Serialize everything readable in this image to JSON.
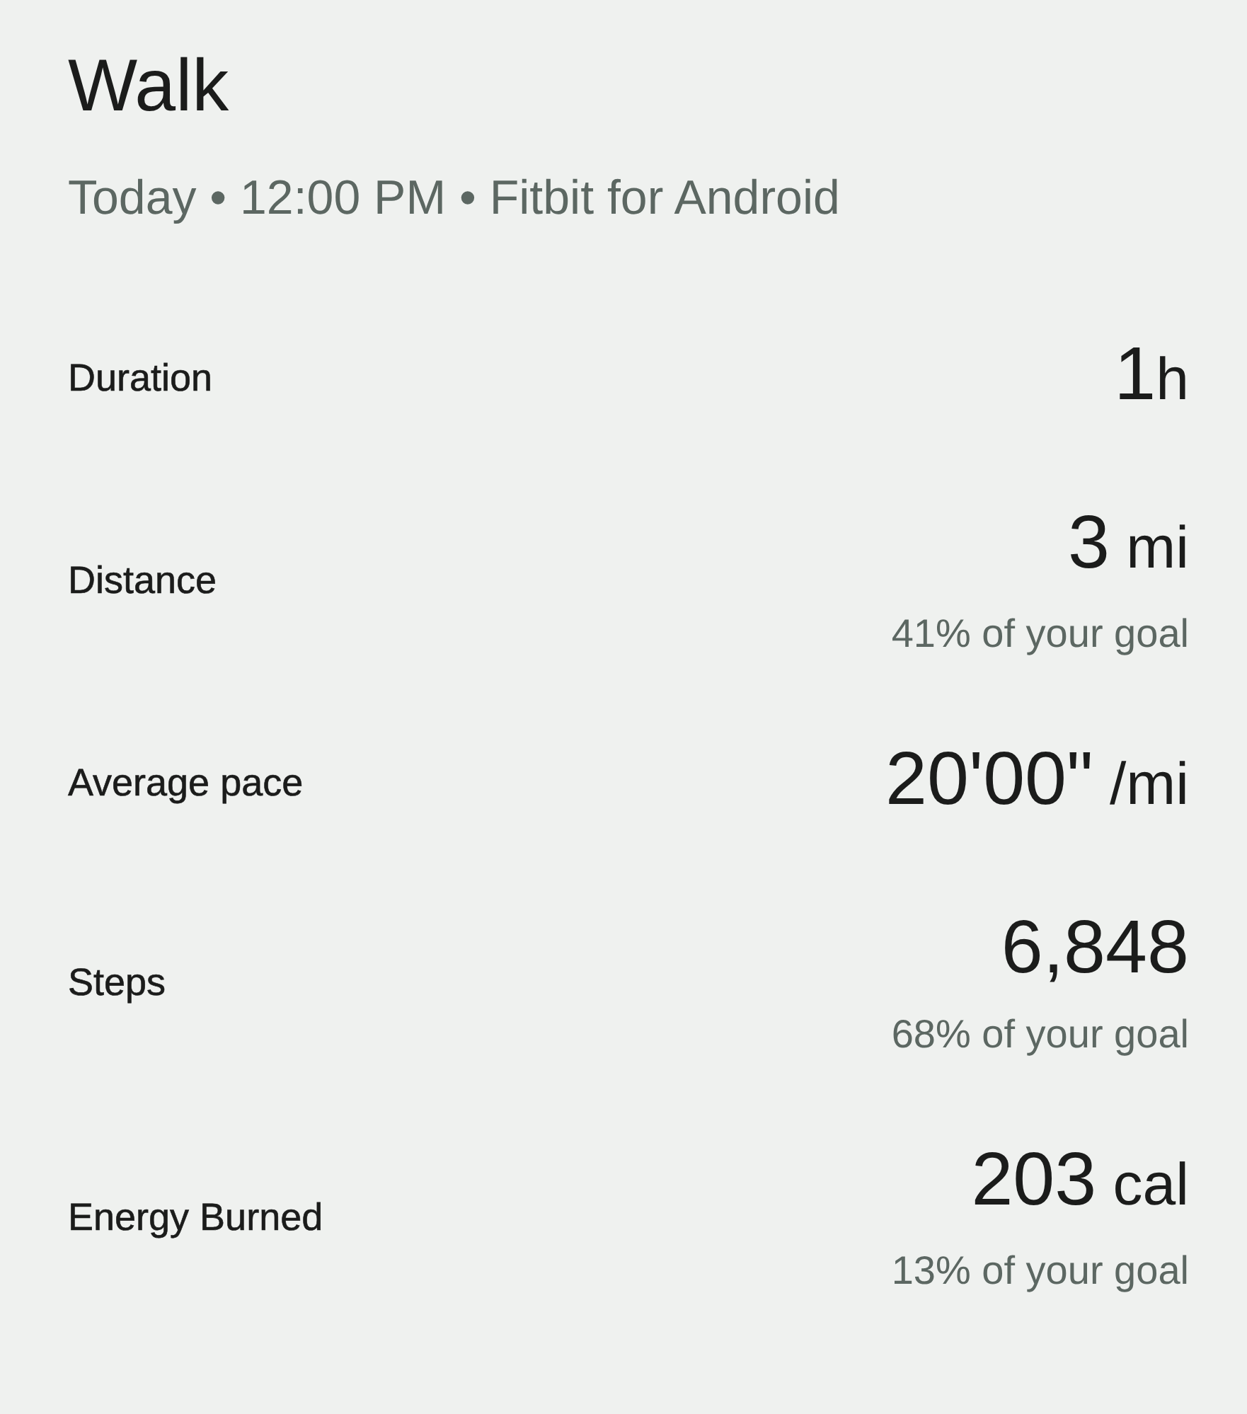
{
  "title": "Walk",
  "subtitle": "Today • 12:00 PM • Fitbit for Android",
  "stats": [
    {
      "label": "Duration",
      "value": "1",
      "unit": "h"
    },
    {
      "label": "Distance",
      "value": "3",
      "unit": " mi",
      "goal": "41% of your goal"
    },
    {
      "label": "Average pace",
      "value": "20'00\"",
      "unit": " /mi"
    },
    {
      "label": "Steps",
      "value": "6,848",
      "goal": "68% of your goal"
    },
    {
      "label": "Energy Burned",
      "value": "203",
      "unit": " cal",
      "goal": "13% of your goal"
    }
  ]
}
